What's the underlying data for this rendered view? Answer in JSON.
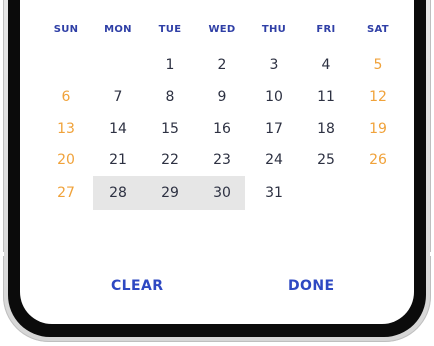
{
  "colors": {
    "weekday_header": "#2f3fa6",
    "weekday_number": "#2d3142",
    "weekend_number": "#f0a23a",
    "selected_range": "#e6e6e6",
    "action_text": "#2e48c2"
  },
  "calendar": {
    "weekdays": [
      "SUN",
      "MON",
      "TUE",
      "WED",
      "THU",
      "FRI",
      "SAT"
    ],
    "weeks": [
      [
        "",
        "",
        "1",
        "2",
        "3",
        "4",
        "5"
      ],
      [
        "6",
        "7",
        "8",
        "9",
        "10",
        "11",
        "12"
      ],
      [
        "13",
        "14",
        "15",
        "16",
        "17",
        "18",
        "19"
      ],
      [
        "20",
        "21",
        "22",
        "23",
        "24",
        "25",
        "26"
      ],
      [
        "27",
        "28",
        "29",
        "30",
        "31",
        "",
        ""
      ]
    ],
    "selected_range": [
      "28",
      "29",
      "30"
    ]
  },
  "actions": {
    "clear_label": "CLEAR",
    "done_label": "DONE"
  }
}
